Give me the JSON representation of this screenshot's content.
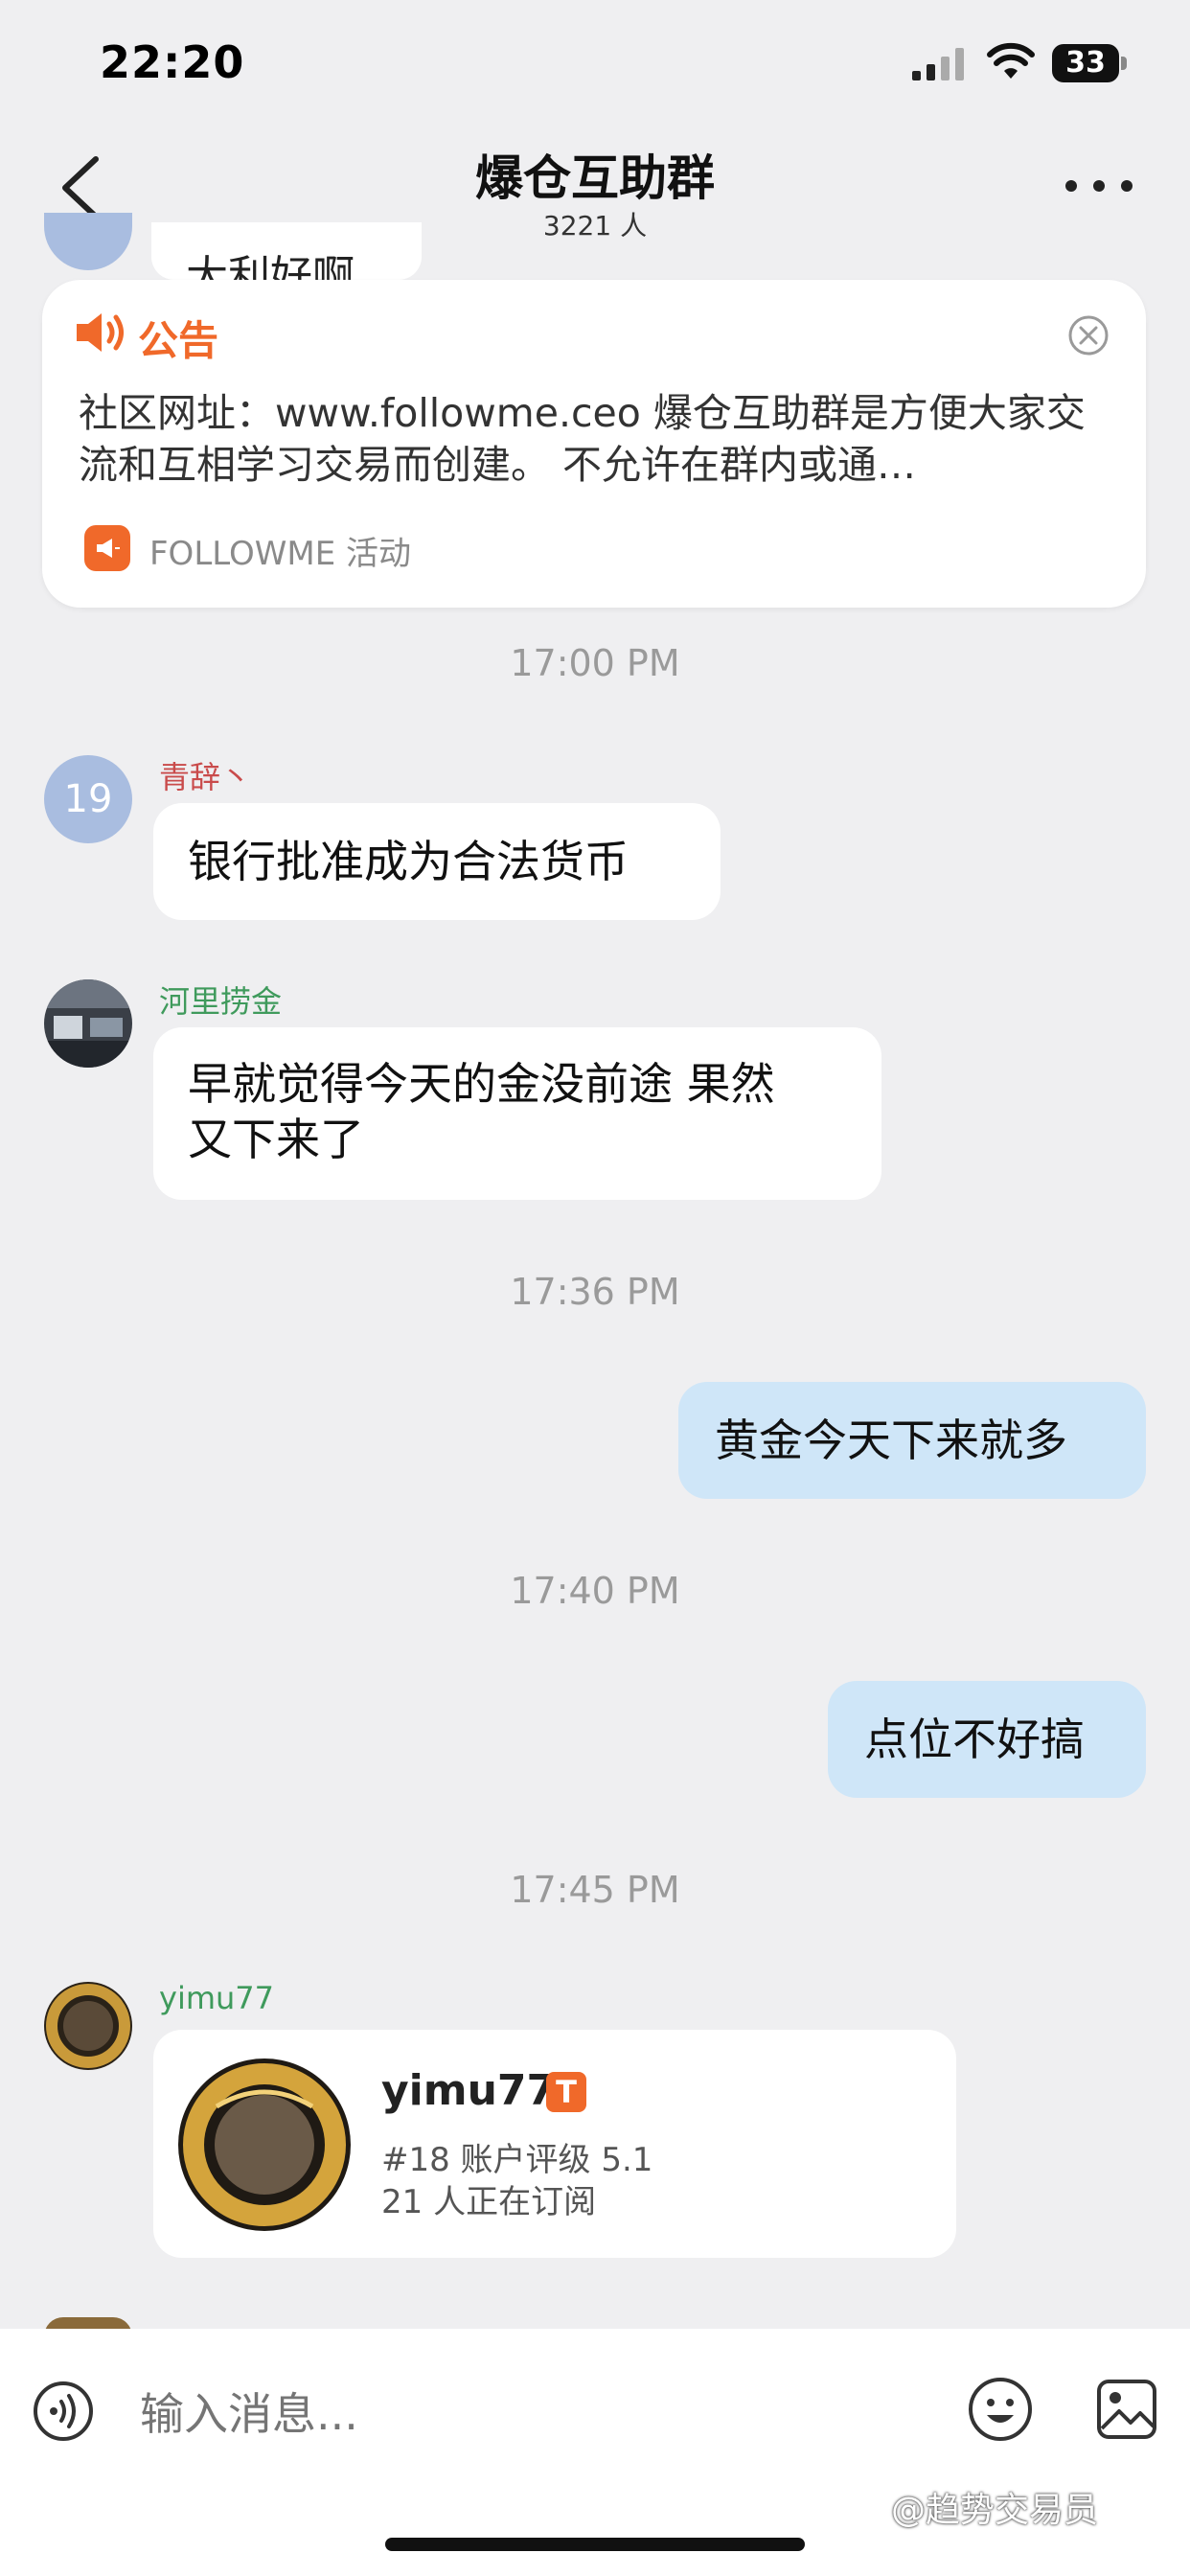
{
  "status_bar": {
    "time": "22:20",
    "battery": "33"
  },
  "nav": {
    "title": "爆仓互助群",
    "member_count": "3221 人"
  },
  "peek_message": {
    "text": "大利好啊"
  },
  "announcement": {
    "label": "公告",
    "text": "社区网址：www.followme.ceo 爆仓互助群是方便大家交流和互相学习交易而创建。 不允许在群内或通…",
    "source": "FOLLOWME 活动"
  },
  "timestamps": [
    "17:00 PM",
    "17:36 PM",
    "17:40 PM",
    "17:45 PM"
  ],
  "messages": [
    {
      "avatar_text": "19",
      "sender": "青辞丶",
      "sender_color": "#c94b4b",
      "text": "银行批准成为合法货币"
    },
    {
      "sender": "河里捞金",
      "sender_color": "#3f9a5c",
      "text_line1": "早就觉得今天的金没前途 果然",
      "text_line2": "又下来了"
    },
    {
      "text": "黄金今天下来就多",
      "outgoing": true
    },
    {
      "text": "点位不好搞",
      "outgoing": true
    },
    {
      "sender": "yimu77",
      "sender_color": "#3f9a5c"
    }
  ],
  "profile_card": {
    "name": "yimu77",
    "badge": "T",
    "rank_line": "#18 账户评级 5.1",
    "subscribers": "21 人正在订阅"
  },
  "input": {
    "placeholder": "输入消息..."
  },
  "watermark": "@趋势交易员",
  "colors": {
    "accent": "#f0692a",
    "outgoing_bubble": "#cfe6f8",
    "background": "#efeff1"
  },
  "icons": [
    "back-icon",
    "more-icon",
    "speaker-icon",
    "close-icon",
    "megaphone-icon",
    "voice-icon",
    "emoji-icon",
    "image-icon"
  ]
}
